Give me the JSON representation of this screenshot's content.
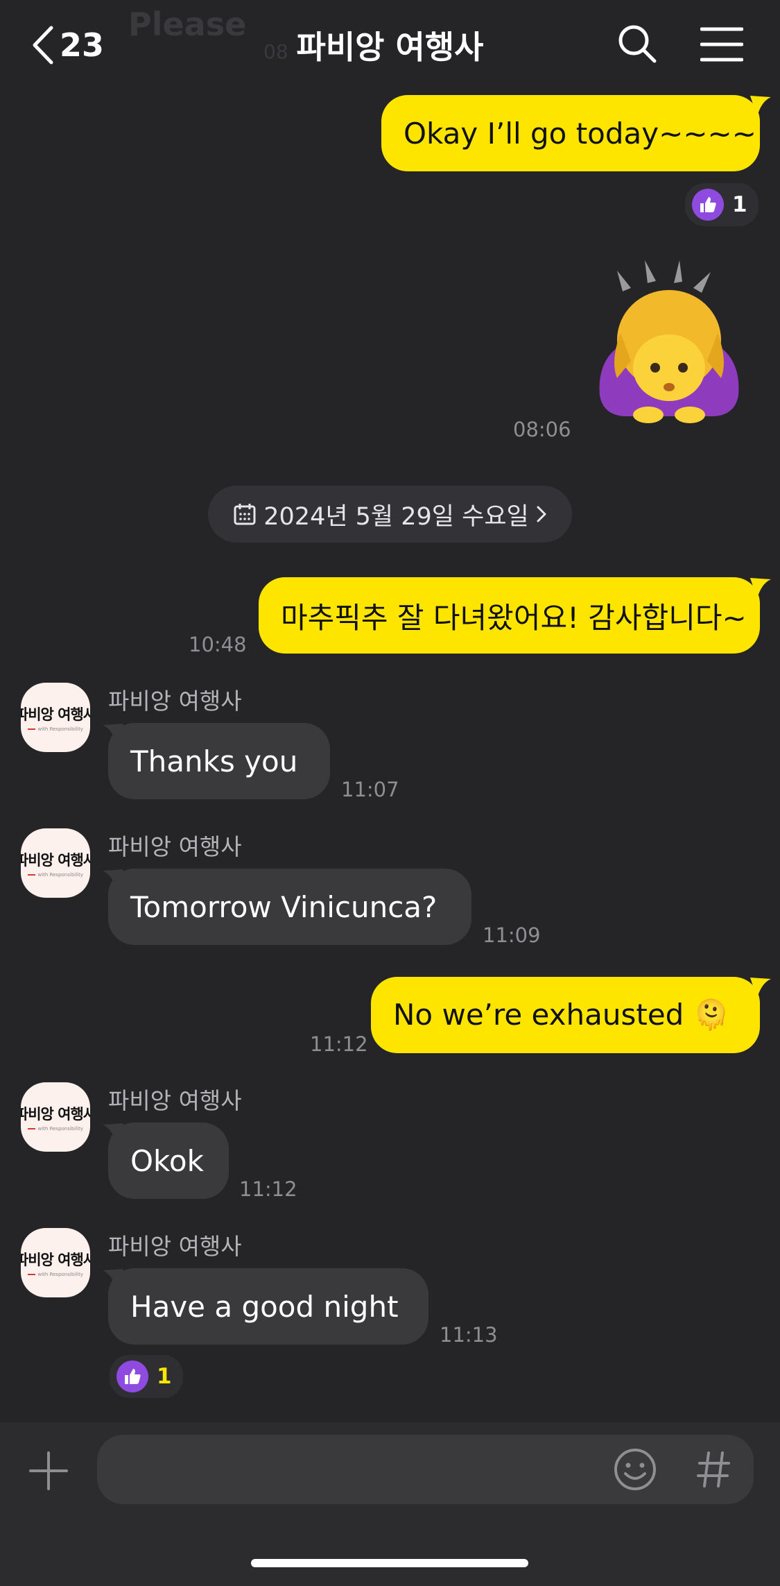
{
  "header": {
    "ghost_text": "Please",
    "ghost_time": "08",
    "back_count": "23",
    "title": "파비앙 여행사"
  },
  "messages": {
    "m1": {
      "text": "Okay I’ll go today~~~~",
      "reaction_count": "1"
    },
    "m2": {
      "time": "08:06",
      "sticker": "woman-bowing"
    },
    "date_divider": {
      "text": "2024년 5월 29일 수요일"
    },
    "m3": {
      "text": "마추픽추 잘 다녀왔어요! 감사합니다~",
      "time": "10:48"
    },
    "m4": {
      "sender": "파비앙 여행사",
      "text": "Thanks you",
      "time": "11:07"
    },
    "m5": {
      "sender": "파비앙 여행사",
      "text": "Tomorrow Vinicunca?",
      "time": "11:09"
    },
    "m6": {
      "text": "No we’re exhausted 🫠",
      "time": "11:12"
    },
    "m7": {
      "sender": "파비앙 여행사",
      "text": "Okok",
      "time": "11:12"
    },
    "m8": {
      "sender": "파비앙 여행사",
      "text": "Have a good night",
      "time": "11:13",
      "reaction_count": "1"
    }
  },
  "avatar": {
    "name": "파비앙 여행사",
    "tagline": "with Responsibility"
  },
  "input": {
    "placeholder": ""
  },
  "colors": {
    "background": "#252528",
    "outgoing_bubble": "#fee500",
    "incoming_bubble": "#3a3a3d",
    "reaction": "#8f4be0"
  }
}
